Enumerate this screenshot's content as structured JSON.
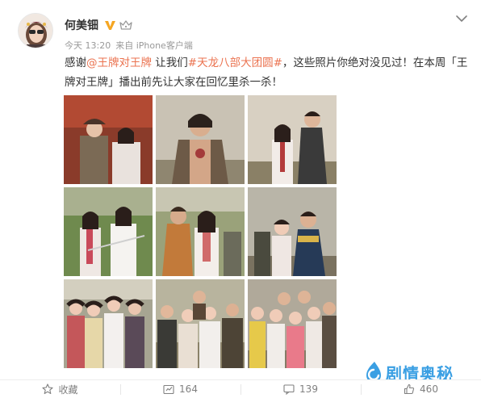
{
  "user": {
    "name": "何美钿",
    "verified_badge": "V",
    "badge_color": "#f5a623"
  },
  "meta": {
    "time": "今天 13:20",
    "source": "来自 iPhone客户端"
  },
  "content": {
    "t1": "感谢",
    "mention": "@王牌对王牌",
    "t2": " 让我们",
    "hashtag": "#天龙八部大团圆#",
    "t3": "，这些照片你绝对没见过！在本周「王牌对王牌」播出前先让大家在回忆里杀一杀！"
  },
  "photos": [
    "photo-1",
    "photo-2",
    "photo-3",
    "photo-4",
    "photo-5",
    "photo-6",
    "photo-7",
    "photo-8",
    "photo-9"
  ],
  "watermark": {
    "text": "剧情奥秘",
    "color": "#3a9fe3"
  },
  "footer": {
    "favorite_label": "收藏",
    "repost_count": "164",
    "comment_count": "139",
    "like_count": "460"
  },
  "colors": {
    "link": "#eb7350",
    "meta": "#999999",
    "text": "#333333"
  }
}
